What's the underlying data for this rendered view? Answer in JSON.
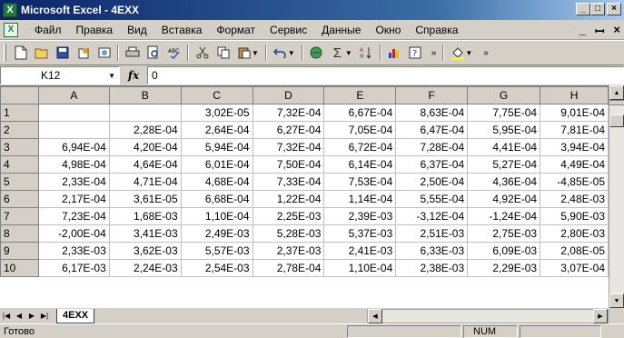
{
  "window": {
    "title": "Microsoft Excel - 4EXX",
    "min": "_",
    "max": "□",
    "close": "×"
  },
  "menu": {
    "items": [
      "Файл",
      "Правка",
      "Вид",
      "Вставка",
      "Формат",
      "Сервис",
      "Данные",
      "Окно",
      "Справка"
    ],
    "doc_min": "_",
    "doc_restore": "ꟷ",
    "doc_close": "×"
  },
  "formula": {
    "namebox": "K12",
    "fx": "fx",
    "value": "0"
  },
  "columns": [
    "A",
    "B",
    "C",
    "D",
    "E",
    "F",
    "G",
    "H"
  ],
  "rows": [
    {
      "n": "1",
      "cells": [
        "",
        "",
        "3,02E-05",
        "7,32E-04",
        "6,67E-04",
        "8,63E-04",
        "7,75E-04",
        "9,01E-04"
      ]
    },
    {
      "n": "2",
      "cells": [
        "",
        "2,28E-04",
        "2,64E-04",
        "6,27E-04",
        "7,05E-04",
        "6,47E-04",
        "5,95E-04",
        "7,81E-04"
      ]
    },
    {
      "n": "3",
      "cells": [
        "6,94E-04",
        "4,20E-04",
        "5,94E-04",
        "7,32E-04",
        "6,72E-04",
        "7,28E-04",
        "4,41E-04",
        "3,94E-04"
      ]
    },
    {
      "n": "4",
      "cells": [
        "4,98E-04",
        "4,64E-04",
        "6,01E-04",
        "7,50E-04",
        "6,14E-04",
        "6,37E-04",
        "5,27E-04",
        "4,49E-04"
      ]
    },
    {
      "n": "5",
      "cells": [
        "2,33E-04",
        "4,71E-04",
        "4,68E-04",
        "7,33E-04",
        "7,53E-04",
        "2,50E-04",
        "4,36E-04",
        "-4,85E-05"
      ]
    },
    {
      "n": "6",
      "cells": [
        "2,17E-04",
        "3,61E-05",
        "6,68E-04",
        "1,22E-04",
        "1,14E-04",
        "5,55E-04",
        "4,92E-04",
        "2,48E-03"
      ]
    },
    {
      "n": "7",
      "cells": [
        "7,23E-04",
        "1,68E-03",
        "1,10E-04",
        "2,25E-03",
        "2,39E-03",
        "-3,12E-04",
        "-1,24E-04",
        "5,90E-03"
      ]
    },
    {
      "n": "8",
      "cells": [
        "-2,00E-04",
        "3,41E-03",
        "2,49E-03",
        "5,28E-03",
        "5,37E-03",
        "2,51E-03",
        "2,75E-03",
        "2,80E-03"
      ]
    },
    {
      "n": "9",
      "cells": [
        "2,33E-03",
        "3,62E-03",
        "5,57E-03",
        "2,37E-03",
        "2,41E-03",
        "6,33E-03",
        "6,09E-03",
        "2,08E-05"
      ]
    },
    {
      "n": "10",
      "cells": [
        "6,17E-03",
        "2,24E-03",
        "2,54E-03",
        "2,78E-04",
        "1,10E-04",
        "2,38E-03",
        "2,29E-03",
        "3,07E-04"
      ]
    }
  ],
  "sheets": {
    "active": "4EXX"
  },
  "status": {
    "text": "Готово",
    "num": "NUM"
  },
  "colors": {
    "title_bar": "#0a246a",
    "excel_green": "#1d7a3a",
    "chrome": "#d4d0c8"
  },
  "icons": [
    "new-icon",
    "open-icon",
    "save-icon",
    "permission-icon",
    "research-icon",
    "print-icon",
    "print-preview-icon",
    "spelling-icon",
    "cut-icon",
    "copy-icon",
    "paste-icon",
    "undo-icon",
    "hyperlink-icon",
    "autosum-icon",
    "sort-ascending-icon",
    "chart-wizard-icon",
    "help-icon",
    "fill-color-icon"
  ]
}
